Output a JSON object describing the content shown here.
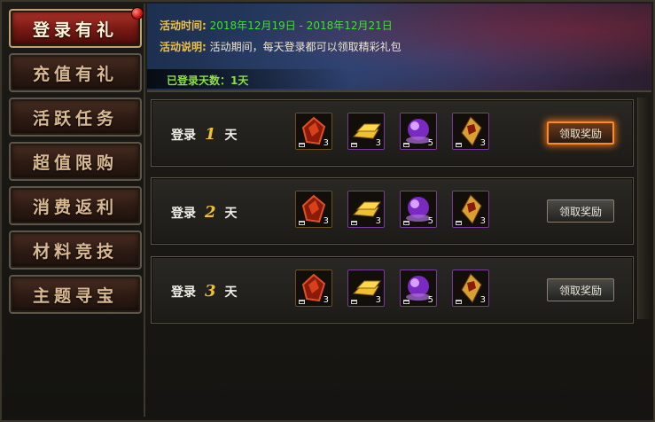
{
  "sidebar": {
    "items": [
      {
        "label": "登录有礼",
        "active": true
      },
      {
        "label": "充值有礼",
        "active": false
      },
      {
        "label": "活跃任务",
        "active": false
      },
      {
        "label": "超值限购",
        "active": false
      },
      {
        "label": "消费返利",
        "active": false
      },
      {
        "label": "材料竞技",
        "active": false
      },
      {
        "label": "主题寻宝",
        "active": false
      }
    ]
  },
  "banner": {
    "time_label": "活动时间:",
    "time_value": "2018年12月19日 - 2018年12月21日",
    "desc_label": "活动说明:",
    "desc_value": "活动期间，每天登录都可以领取精彩礼包",
    "days_text": "已登录天数：1天"
  },
  "rewards": [
    {
      "prefix": "登录",
      "day": "1",
      "suffix": "天",
      "items": [
        {
          "icon": "red-gem-icon",
          "count": "3"
        },
        {
          "icon": "gold-bar-icon",
          "count": "3"
        },
        {
          "icon": "purple-orb-icon",
          "count": "5"
        },
        {
          "icon": "gold-token-icon",
          "count": "3"
        }
      ],
      "button": "领取奖励",
      "highlight": true
    },
    {
      "prefix": "登录",
      "day": "2",
      "suffix": "天",
      "items": [
        {
          "icon": "red-gem-icon",
          "count": "3"
        },
        {
          "icon": "gold-bar-icon",
          "count": "3"
        },
        {
          "icon": "purple-orb-icon",
          "count": "5"
        },
        {
          "icon": "gold-token-icon",
          "count": "3"
        }
      ],
      "button": "领取奖励",
      "highlight": false
    },
    {
      "prefix": "登录",
      "day": "3",
      "suffix": "天",
      "items": [
        {
          "icon": "red-gem-icon",
          "count": "3"
        },
        {
          "icon": "gold-bar-icon",
          "count": "3"
        },
        {
          "icon": "purple-orb-icon",
          "count": "5"
        },
        {
          "icon": "gold-token-icon",
          "count": "3"
        }
      ],
      "button": "领取奖励",
      "highlight": false
    }
  ]
}
